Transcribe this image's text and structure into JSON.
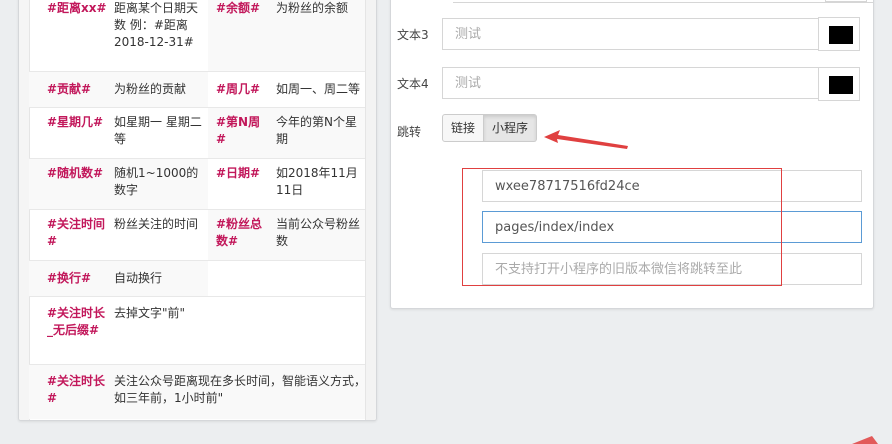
{
  "vars_table": {
    "rows": [
      {
        "var": "#距离xx#",
        "desc": "距离某个日期天数 例：#距离2018-12-31#",
        "var2": "#余额#",
        "desc2": "为粉丝的余额"
      },
      {
        "var": "#贡献#",
        "desc": "为粉丝的贡献",
        "var2": "#周几#",
        "desc2": "如周一、周二等"
      },
      {
        "var": "#星期几#",
        "desc": "如星期一 星期二等",
        "var2": "#第N周#",
        "desc2": "今年的第N个星期"
      },
      {
        "var": "#随机数#",
        "desc": "随机1~1000的数字",
        "var2": "#日期#",
        "desc2": "如2018年11月11日"
      },
      {
        "var": "#关注时间#",
        "desc": "粉丝关注的时间",
        "var2": "#粉丝总数#",
        "desc2": "当前公众号粉丝数"
      },
      {
        "var": "#换行#",
        "desc": "自动换行",
        "var2": "",
        "desc2": ""
      }
    ],
    "wide_rows": [
      {
        "var": "#关注时长_无后缀#",
        "desc": "去掉文字\"前\""
      },
      {
        "var": "#关注时长#",
        "desc": "关注公众号距离现在多长时间，智能语义方式，如三年前，1小时前\""
      }
    ]
  },
  "form": {
    "text3": {
      "label": "文本3",
      "placeholder": "测试",
      "color": "#000000"
    },
    "text4": {
      "label": "文本4",
      "placeholder": "测试",
      "color": "#000000"
    },
    "jump": {
      "label": "跳转",
      "options": [
        "链接",
        "小程序"
      ],
      "selected": "小程序"
    },
    "appid": {
      "value": "wxee78717516fd24ce"
    },
    "pagepath": {
      "value": "pages/index/index"
    },
    "fallback": {
      "placeholder": "不支持打开小程序的旧版本微信将跳转至此"
    }
  },
  "annotation": {
    "color": "#e04040"
  }
}
